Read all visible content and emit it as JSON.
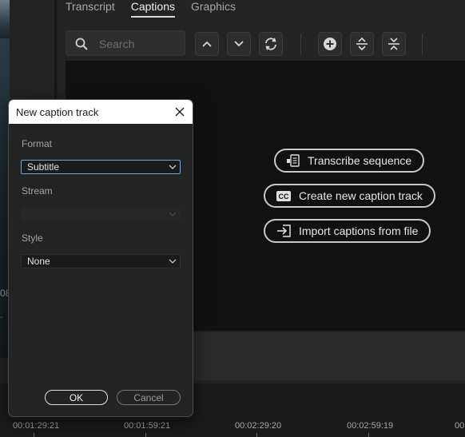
{
  "panel": {
    "tabs": [
      {
        "label": "Transcript"
      },
      {
        "label": "Captions"
      },
      {
        "label": "Graphics"
      }
    ],
    "active_tab": "Captions",
    "search": {
      "placeholder": "Search",
      "icon": "search-icon"
    },
    "toolbar_icons": [
      "chevron-up-icon",
      "chevron-down-icon",
      "sync-icon",
      "add-icon",
      "split-icon",
      "merge-icon"
    ]
  },
  "actions": {
    "transcribe": {
      "label": "Transcribe sequence",
      "icon": "transcribe-icon"
    },
    "create": {
      "label": "Create new caption track",
      "icon": "cc-icon"
    },
    "import": {
      "label": "Import captions from file",
      "icon": "import-icon"
    }
  },
  "left_panel": {
    "frame_digit": "08",
    "frame_dash": "-"
  },
  "timeline": {
    "timecodes": [
      "00:01:29:21",
      "00:01:59:21",
      "00:02:29:20",
      "00:02:59:19",
      "00:0"
    ]
  },
  "dialog": {
    "title": "New caption track",
    "format_label": "Format",
    "format_value": "Subtitle",
    "stream_label": "Stream",
    "stream_value": "",
    "style_label": "Style",
    "style_value": "None",
    "ok_label": "OK",
    "cancel_label": "Cancel"
  },
  "colors": {
    "focus_border": "#6ea4e6",
    "dialog_bg": "#232323",
    "title_bar": "#ffffff"
  }
}
